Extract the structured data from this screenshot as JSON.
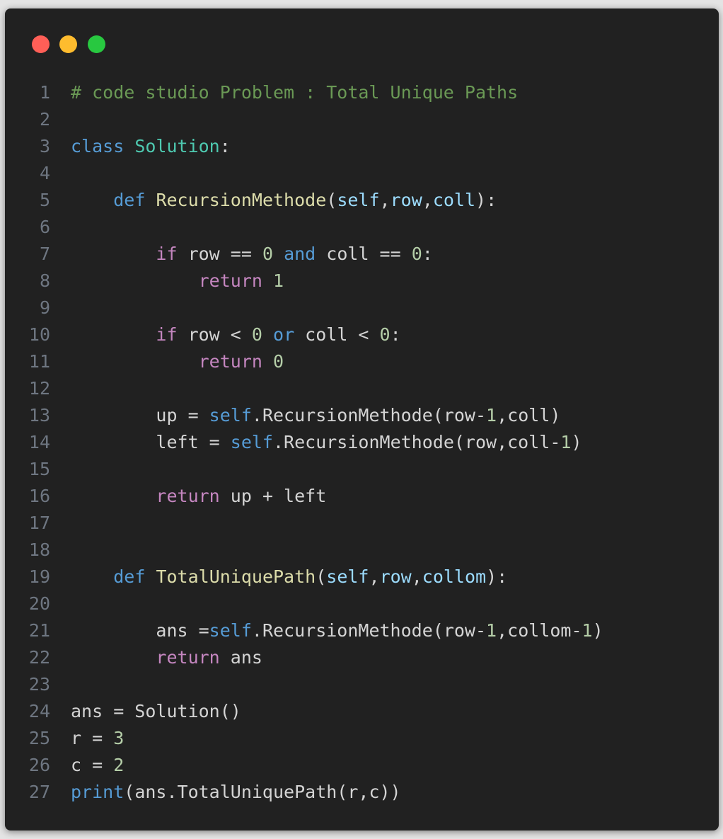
{
  "window": {
    "controls": [
      {
        "name": "close",
        "color": "#ff5f57"
      },
      {
        "name": "minimize",
        "color": "#febc2e"
      },
      {
        "name": "maximize",
        "color": "#28c840"
      }
    ]
  },
  "colors": {
    "background": "#212121",
    "comment": "#6a9955",
    "keyword": "#569cd6",
    "control": "#c586c0",
    "class": "#4ec9b0",
    "function": "#dcdcaa",
    "parameter": "#9cdcfe",
    "number": "#b5cea8",
    "text": "#d4d4d4",
    "line_number": "#6e7681"
  },
  "code": {
    "language": "python",
    "lines": [
      {
        "n": "1",
        "tokens": [
          {
            "t": "comment",
            "v": "# code studio Problem : Total Unique Paths"
          }
        ]
      },
      {
        "n": "2",
        "tokens": []
      },
      {
        "n": "3",
        "tokens": [
          {
            "t": "keyword",
            "v": "class"
          },
          {
            "t": "plain",
            "v": " "
          },
          {
            "t": "class",
            "v": "Solution"
          },
          {
            "t": "plain",
            "v": ":"
          }
        ]
      },
      {
        "n": "4",
        "tokens": []
      },
      {
        "n": "5",
        "tokens": [
          {
            "t": "plain",
            "v": "    "
          },
          {
            "t": "keyword",
            "v": "def"
          },
          {
            "t": "plain",
            "v": " "
          },
          {
            "t": "func",
            "v": "RecursionMethode"
          },
          {
            "t": "plain",
            "v": "("
          },
          {
            "t": "param",
            "v": "self"
          },
          {
            "t": "plain",
            "v": ","
          },
          {
            "t": "param",
            "v": "row"
          },
          {
            "t": "plain",
            "v": ","
          },
          {
            "t": "param",
            "v": "coll"
          },
          {
            "t": "plain",
            "v": "):"
          }
        ]
      },
      {
        "n": "6",
        "tokens": []
      },
      {
        "n": "7",
        "tokens": [
          {
            "t": "plain",
            "v": "        "
          },
          {
            "t": "control",
            "v": "if"
          },
          {
            "t": "plain",
            "v": " row == "
          },
          {
            "t": "number",
            "v": "0"
          },
          {
            "t": "plain",
            "v": " "
          },
          {
            "t": "keyword",
            "v": "and"
          },
          {
            "t": "plain",
            "v": " coll == "
          },
          {
            "t": "number",
            "v": "0"
          },
          {
            "t": "plain",
            "v": ":"
          }
        ]
      },
      {
        "n": "8",
        "tokens": [
          {
            "t": "plain",
            "v": "            "
          },
          {
            "t": "control",
            "v": "return"
          },
          {
            "t": "plain",
            "v": " "
          },
          {
            "t": "number",
            "v": "1"
          }
        ]
      },
      {
        "n": "9",
        "tokens": []
      },
      {
        "n": "10",
        "tokens": [
          {
            "t": "plain",
            "v": "        "
          },
          {
            "t": "control",
            "v": "if"
          },
          {
            "t": "plain",
            "v": " row < "
          },
          {
            "t": "number",
            "v": "0"
          },
          {
            "t": "plain",
            "v": " "
          },
          {
            "t": "keyword",
            "v": "or"
          },
          {
            "t": "plain",
            "v": " coll < "
          },
          {
            "t": "number",
            "v": "0"
          },
          {
            "t": "plain",
            "v": ":"
          }
        ]
      },
      {
        "n": "11",
        "tokens": [
          {
            "t": "plain",
            "v": "            "
          },
          {
            "t": "control",
            "v": "return"
          },
          {
            "t": "plain",
            "v": " "
          },
          {
            "t": "number",
            "v": "0"
          }
        ]
      },
      {
        "n": "12",
        "tokens": []
      },
      {
        "n": "13",
        "tokens": [
          {
            "t": "plain",
            "v": "        up = "
          },
          {
            "t": "keyword",
            "v": "self"
          },
          {
            "t": "plain",
            "v": ".RecursionMethode(row-"
          },
          {
            "t": "number",
            "v": "1"
          },
          {
            "t": "plain",
            "v": ",coll)"
          }
        ]
      },
      {
        "n": "14",
        "tokens": [
          {
            "t": "plain",
            "v": "        left = "
          },
          {
            "t": "keyword",
            "v": "self"
          },
          {
            "t": "plain",
            "v": ".RecursionMethode(row,coll-"
          },
          {
            "t": "number",
            "v": "1"
          },
          {
            "t": "plain",
            "v": ")"
          }
        ]
      },
      {
        "n": "15",
        "tokens": []
      },
      {
        "n": "16",
        "tokens": [
          {
            "t": "plain",
            "v": "        "
          },
          {
            "t": "control",
            "v": "return"
          },
          {
            "t": "plain",
            "v": " up + left"
          }
        ]
      },
      {
        "n": "17",
        "tokens": []
      },
      {
        "n": "18",
        "tokens": []
      },
      {
        "n": "19",
        "tokens": [
          {
            "t": "plain",
            "v": "    "
          },
          {
            "t": "keyword",
            "v": "def"
          },
          {
            "t": "plain",
            "v": " "
          },
          {
            "t": "func",
            "v": "TotalUniquePath"
          },
          {
            "t": "plain",
            "v": "("
          },
          {
            "t": "param",
            "v": "self"
          },
          {
            "t": "plain",
            "v": ","
          },
          {
            "t": "param",
            "v": "row"
          },
          {
            "t": "plain",
            "v": ","
          },
          {
            "t": "param",
            "v": "collom"
          },
          {
            "t": "plain",
            "v": "):"
          }
        ]
      },
      {
        "n": "20",
        "tokens": []
      },
      {
        "n": "21",
        "tokens": [
          {
            "t": "plain",
            "v": "        ans ="
          },
          {
            "t": "keyword",
            "v": "self"
          },
          {
            "t": "plain",
            "v": ".RecursionMethode(row-"
          },
          {
            "t": "number",
            "v": "1"
          },
          {
            "t": "plain",
            "v": ",collom-"
          },
          {
            "t": "number",
            "v": "1"
          },
          {
            "t": "plain",
            "v": ")"
          }
        ]
      },
      {
        "n": "22",
        "tokens": [
          {
            "t": "plain",
            "v": "        "
          },
          {
            "t": "control",
            "v": "return"
          },
          {
            "t": "plain",
            "v": " ans"
          }
        ]
      },
      {
        "n": "23",
        "tokens": []
      },
      {
        "n": "24",
        "tokens": [
          {
            "t": "plain",
            "v": "ans = Solution()"
          }
        ]
      },
      {
        "n": "25",
        "tokens": [
          {
            "t": "plain",
            "v": "r = "
          },
          {
            "t": "number",
            "v": "3"
          }
        ]
      },
      {
        "n": "26",
        "tokens": [
          {
            "t": "plain",
            "v": "c = "
          },
          {
            "t": "number",
            "v": "2"
          }
        ]
      },
      {
        "n": "27",
        "tokens": [
          {
            "t": "builtin",
            "v": "print"
          },
          {
            "t": "plain",
            "v": "(ans.TotalUniquePath(r,c))"
          }
        ]
      }
    ]
  }
}
